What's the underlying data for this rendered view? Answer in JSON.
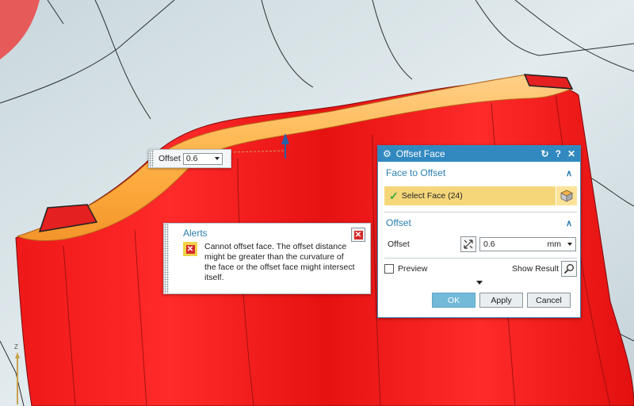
{
  "mini_offset": {
    "label": "Offset",
    "value": "0.6"
  },
  "alerts": {
    "title": "Alerts",
    "message": "Cannot offset face. The offset distance might be greater than the curvature of the face or the offset face might intersect itself."
  },
  "dialog": {
    "title": "Offset Face",
    "title_buttons": {
      "reset": "↻",
      "help": "?",
      "close": "✕"
    },
    "face_section": {
      "title": "Face to Offset",
      "select_label": "Select Face (24)"
    },
    "offset_section": {
      "title": "Offset",
      "label": "Offset",
      "value": "0.6",
      "unit": "mm"
    },
    "preview_label": "Preview",
    "show_result_label": "Show Result",
    "buttons": {
      "ok": "OK",
      "apply": "Apply",
      "cancel": "Cancel"
    }
  },
  "triad": {
    "z_label": "Z"
  },
  "colors": {
    "part_red": "#ff1a1a",
    "selected_face": "#ffb347",
    "title_bar": "#3189c0",
    "select_highlight": "#f5d77a"
  }
}
